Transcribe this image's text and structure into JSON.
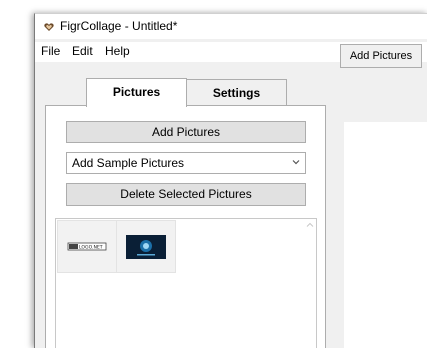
{
  "window": {
    "title": "FigrCollage - Untitled*",
    "app_icon": "heart-icon"
  },
  "menu": [
    "File",
    "Edit",
    "Help"
  ],
  "tabs": [
    {
      "label": "Pictures",
      "active": true
    },
    {
      "label": "Settings",
      "active": false
    }
  ],
  "pictures_panel": {
    "add_button": "Add Pictures",
    "sample_select": "Add Sample Pictures",
    "delete_button": "Delete Selected Pictures"
  },
  "toolbar": {
    "add_pictures": "Add Pictures"
  },
  "thumbnails": [
    {
      "label": "LOGO.NET"
    },
    {
      "label": ""
    }
  ],
  "colors": {
    "panel_bg": "#f0f0f0",
    "button_bg": "#e1e1e1",
    "border": "#adadad"
  }
}
